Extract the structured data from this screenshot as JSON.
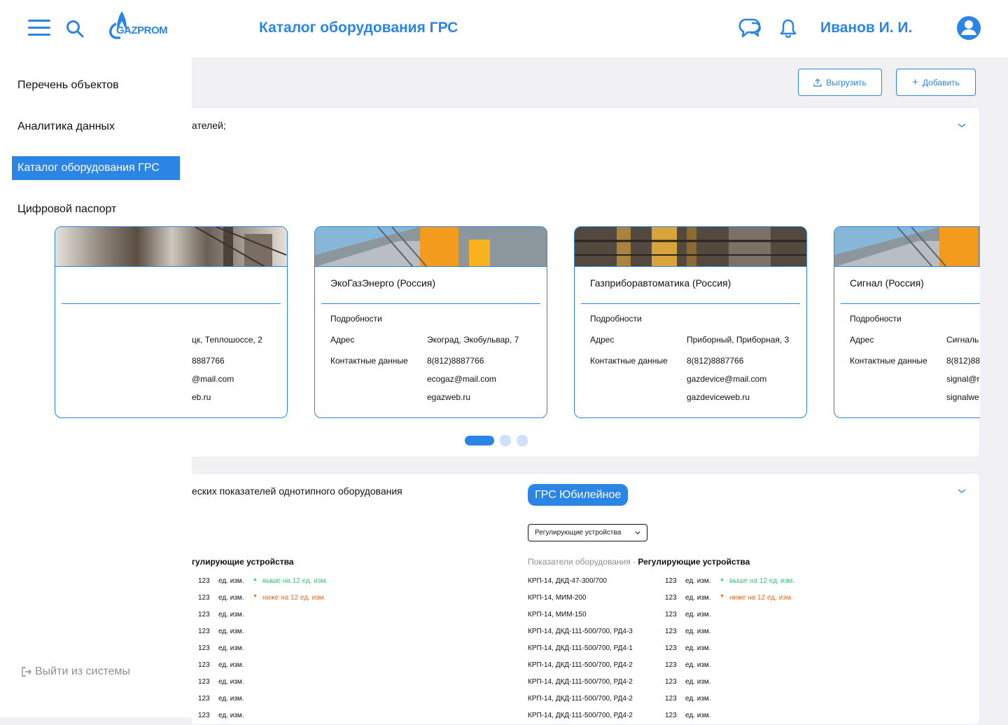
{
  "header": {
    "title": "Каталог оборудования ГРС",
    "logo_text": "GAZPROM",
    "user_name": "Иванов И. И."
  },
  "sidebar": {
    "items": [
      {
        "label": "Перечень объектов"
      },
      {
        "label": "Аналитика данных"
      },
      {
        "label": "Каталог оборудования ГРС"
      },
      {
        "label": "Цифровой паспорт"
      }
    ],
    "logout": "Выйти из системы"
  },
  "toolbar": {
    "export_label": "Выгрузить",
    "add_label": "Добавить"
  },
  "manufacturers": {
    "title_fragment": "ателей;",
    "details_label": "Подробности",
    "address_label": "Адрес",
    "contacts_label": "Контактные данные",
    "partial_card": {
      "address": "цк, Теплошоссе, 2",
      "phone": "8887766",
      "email": "@mail.com",
      "web": "eb.ru"
    },
    "cards": [
      {
        "name": "ЭкоГазЭнерго (Россия)",
        "address": "Экоград, Экобульвар, 7",
        "phone": "8(812)8887766",
        "email": "ecogaz@mail.com",
        "web": "egazweb.ru"
      },
      {
        "name": "Газприборавтоматика (Россия)",
        "address": "Приборный, Приборная, 3",
        "phone": "8(812)8887766",
        "email": "gazdevice@mail.com",
        "web": "gazdeviceweb.ru"
      },
      {
        "name": "Сигнал (Россия)",
        "address": "Сигналь",
        "phone": "8(812)88",
        "email": "signal@r",
        "web": "signalwe"
      }
    ],
    "pagination": {
      "pages": 3,
      "active": 1
    }
  },
  "comparison": {
    "title_fragment": "еских показателей однотипного оборудования",
    "station_badge": "ГРС Юбилейное",
    "select_value": "Регулирующие устройства",
    "left_heading": "гулирующие устройства",
    "right_heading_prefix": "Показатели оборудования - ",
    "right_heading_bold": "Регулирующие устройства",
    "unit": "ед. изм.",
    "up_note": "выше на 12 ед. изм.",
    "down_note": "ниже на 12 ед. изм.",
    "rows": [
      {
        "name": "КРП-14, ДКД-47-300/700",
        "value": "123",
        "trend": "up"
      },
      {
        "name": "КРП-14, МИМ-200",
        "value": "123",
        "trend": "down"
      },
      {
        "name": "КРП-14, МИМ-150",
        "value": "123",
        "trend": ""
      },
      {
        "name": "КРП-14, ДКД-111-500/700, РД4-3",
        "value": "123",
        "trend": ""
      },
      {
        "name": "КРП-14, ДКД-111-500/700, РД4-1",
        "value": "123",
        "trend": ""
      },
      {
        "name": "КРП-14, ДКД-111-500/700, РД4-2",
        "value": "123",
        "trend": ""
      },
      {
        "name": "КРП-14, ДКД-111-500/700, РД4-2",
        "value": "123",
        "trend": ""
      },
      {
        "name": "КРП-14, ДКД-111-500/700, РД4-2",
        "value": "123",
        "trend": ""
      },
      {
        "name": "КРП-14, ДКД-111-500/700, РД4-2",
        "value": "123",
        "trend": ""
      }
    ]
  },
  "colors": {
    "accent": "#2b85e4",
    "up": "#2ecc71",
    "down": "#f06a1d"
  }
}
